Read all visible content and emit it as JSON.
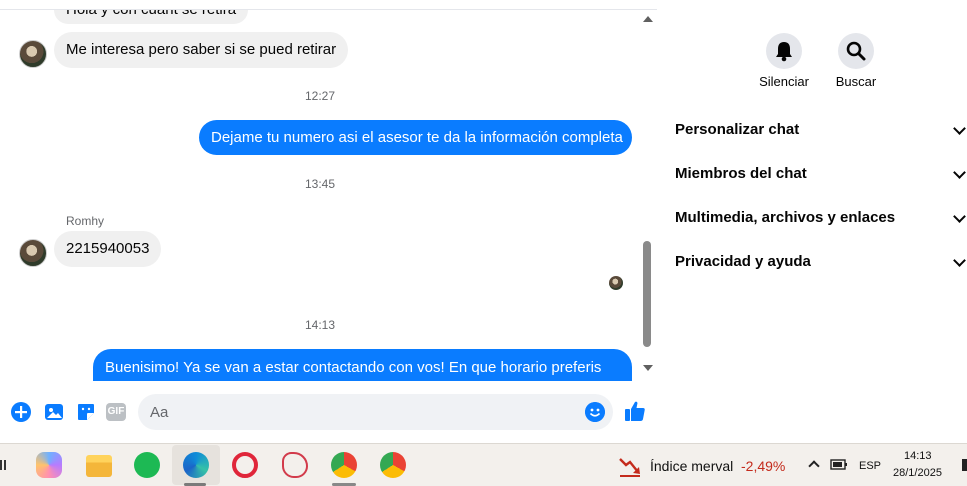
{
  "chat": {
    "messages": [
      {
        "type": "in",
        "text": "Hola y con cuant se retira"
      },
      {
        "type": "in",
        "text": "Me interesa pero saber si se pued retirar"
      },
      {
        "type": "time",
        "text": "12:27"
      },
      {
        "type": "out",
        "text": "Dejame tu numero asi el asesor te da la información completa"
      },
      {
        "type": "time",
        "text": "13:45"
      },
      {
        "type": "sender",
        "text": "Romhy"
      },
      {
        "type": "in",
        "text": "2215940053"
      },
      {
        "type": "time",
        "text": "14:13"
      },
      {
        "type": "out",
        "text": "Buenisimo! Ya se van a estar contactando con vos! En que horario preferis"
      }
    ],
    "composer": {
      "placeholder": "Aa",
      "icons": [
        "plus-icon",
        "image-icon",
        "sticker-icon",
        "gif-icon",
        "emoji-icon",
        "like-icon"
      ],
      "gif_label": "GIF"
    },
    "colors": {
      "outgoing": "#0a7cff",
      "incoming": "#f0f0f0"
    }
  },
  "side": {
    "actions": [
      {
        "label": "Silenciar",
        "icon": "bell-icon"
      },
      {
        "label": "Buscar",
        "icon": "search-icon"
      }
    ],
    "sections": [
      "Personalizar chat",
      "Miembros del chat",
      "Multimedia, archivos y enlaces",
      "Privacidad y ayuda"
    ]
  },
  "taskbar": {
    "apps": [
      "copilot-icon",
      "file-explorer-icon",
      "spotify-icon",
      "edge-icon",
      "opera-icon",
      "snipping-tool-icon",
      "chrome-profile-icon",
      "chrome-icon"
    ],
    "widget": {
      "label": "Índice merval",
      "value": "-2,49%",
      "color": "#c42b1c"
    },
    "tray": {
      "lang": "ESP",
      "time": "14:13",
      "date": "28/1/2025"
    }
  }
}
